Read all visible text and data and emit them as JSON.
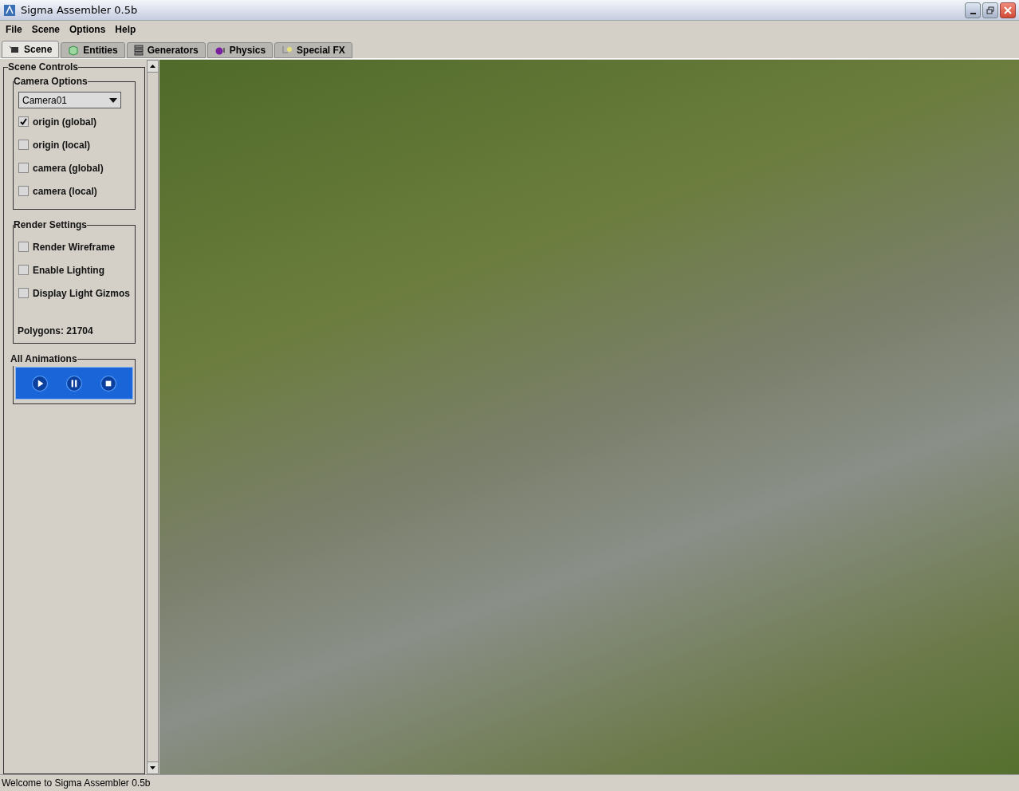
{
  "window": {
    "title": "Sigma Assembler 0.5b"
  },
  "menu": [
    "File",
    "Scene",
    "Options",
    "Help"
  ],
  "tabs": [
    {
      "label": "Scene",
      "selected": true,
      "kind": "scene"
    },
    {
      "label": "Entities",
      "selected": false,
      "kind": "entities"
    },
    {
      "label": "Generators",
      "selected": false,
      "kind": "generators"
    },
    {
      "label": "Physics",
      "selected": false,
      "kind": "physics"
    },
    {
      "label": "Special FX",
      "selected": false,
      "kind": "fx"
    }
  ],
  "scene_controls": {
    "title": "Scene Controls",
    "camera_options": {
      "title": "Camera Options",
      "camera": "Camera01",
      "options": [
        {
          "label": "origin (global)",
          "checked": true
        },
        {
          "label": "origin (local)",
          "checked": false
        },
        {
          "label": "camera (global)",
          "checked": false
        },
        {
          "label": "camera (local)",
          "checked": false
        }
      ]
    },
    "render_settings": {
      "title": "Render Settings",
      "options": [
        {
          "label": "Render Wireframe",
          "checked": false
        },
        {
          "label": "Enable Lighting",
          "checked": false
        },
        {
          "label": "Display Light Gizmos",
          "checked": false
        }
      ],
      "polygons": "Polygons: 21704"
    },
    "all_animations": {
      "title": "All Animations"
    }
  },
  "status_bar": "Welcome to Sigma Assembler 0.5b"
}
